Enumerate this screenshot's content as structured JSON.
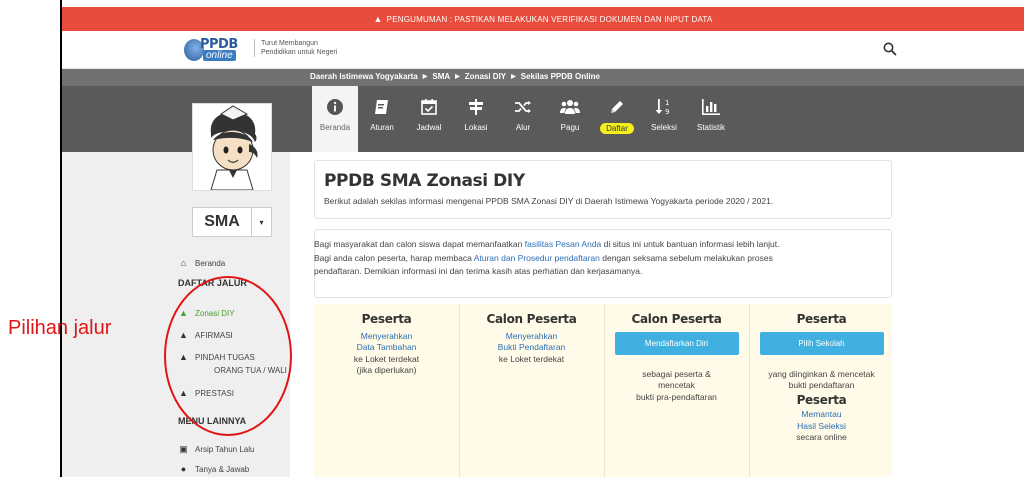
{
  "announcement": {
    "icon": "warning-icon",
    "text": "PENGUMUMAN : PASTIKAN MELAKUKAN VERIFIKASI DOKUMEN DAN INPUT DATA"
  },
  "header": {
    "logo_text": "PPDB",
    "logo_sub": "online",
    "tagline_line1": "Turut Membangun",
    "tagline_line2": "Pendidikan untuk Negeri",
    "search_icon": "search-icon"
  },
  "breadcrumb": [
    "Daerah Istimewa Yogyakarta",
    "SMA",
    "Zonasi DIY",
    "Sekilas PPDB Online"
  ],
  "nav": [
    {
      "label": "Beranda",
      "icon": "info-icon"
    },
    {
      "label": "Aturan",
      "icon": "book-icon"
    },
    {
      "label": "Jadwal",
      "icon": "calendar-check-icon"
    },
    {
      "label": "Lokasi",
      "icon": "signpost-icon"
    },
    {
      "label": "Alur",
      "icon": "shuffle-icon"
    },
    {
      "label": "Pagu",
      "icon": "users-icon"
    },
    {
      "label": "Daftar",
      "icon": "pencil-icon"
    },
    {
      "label": "Seleksi",
      "icon": "sort-numeric-icon"
    },
    {
      "label": "Statistik",
      "icon": "bar-chart-icon"
    }
  ],
  "sidebar": {
    "level_value": "SMA",
    "home_label": "Beranda",
    "daftar_jalur_title": "DAFTAR JALUR",
    "jalur": [
      {
        "label": "Zonasi DIY"
      },
      {
        "label": "AFIRMASI"
      },
      {
        "label": "PINDAH TUGAS",
        "label2": "ORANG TUA / WALI"
      },
      {
        "label": "PRESTASI"
      }
    ],
    "menu_lainnya_title": "MENU LAINNYA",
    "menu_lainnya": [
      {
        "label": "Arsip Tahun Lalu",
        "icon": "archive-icon"
      },
      {
        "label": "Tanya & Jawab",
        "icon": "chat-icon"
      }
    ]
  },
  "annotation": {
    "label": "Pilihan jalur"
  },
  "main": {
    "title": "PPDB SMA Zonasi DIY",
    "intro": "Berikut adalah sekilas informasi mengenai PPDB SMA Zonasi DIY di Daerah Istimewa Yogyakarta periode 2020 / 2021.",
    "info_p1_a": "Bagi masyarakat dan calon siswa dapat memanfaatkan ",
    "info_p1_link": "fasilitas Pesan Anda",
    "info_p1_b": " di situs ini untuk bantuan informasi lebih lanjut.",
    "info_p2_a": "Bagi anda calon peserta, harap membaca ",
    "info_p2_link": "Aturan dan Prosedur pendaftaran",
    "info_p2_b": " dengan seksama sebelum melakukan proses",
    "info_p3": "pendaftaran. Demikian informasi ini dan terima kasih atas perhatian dan kerjasamanya."
  },
  "steps": [
    {
      "title": "Peserta",
      "link1": "Menyerahkan",
      "link2": "Data Tambahan",
      "text1": "ke Loket terdekat",
      "text2": "(jika diperlukan)"
    },
    {
      "title": "Calon Peserta",
      "link1": "Menyerahkan",
      "link2": "Bukti Pendaftaran",
      "text1": "ke Loket terdekat"
    },
    {
      "title": "Calon Peserta",
      "button": "Mendaftarkan Diri",
      "text1": "sebagai peserta &",
      "text2": "mencetak",
      "text3": "bukti pra-pendaftaran"
    },
    {
      "title": "Peserta",
      "button": "Pilih Sekolah",
      "text1": "yang diinginkan & mencetak",
      "text2": "bukti pendaftaran",
      "title2": "Peserta",
      "link1": "Memantau",
      "link2": "Hasil Seleksi",
      "text3": "secara online"
    }
  ],
  "colors": {
    "announce_bg": "#e74c3c",
    "nav_bg": "#5a5a5a",
    "accent_blue": "#3fb0df",
    "highlight": "#f5ef1c",
    "annotation": "#e01515",
    "green": "#4a9d2e"
  }
}
